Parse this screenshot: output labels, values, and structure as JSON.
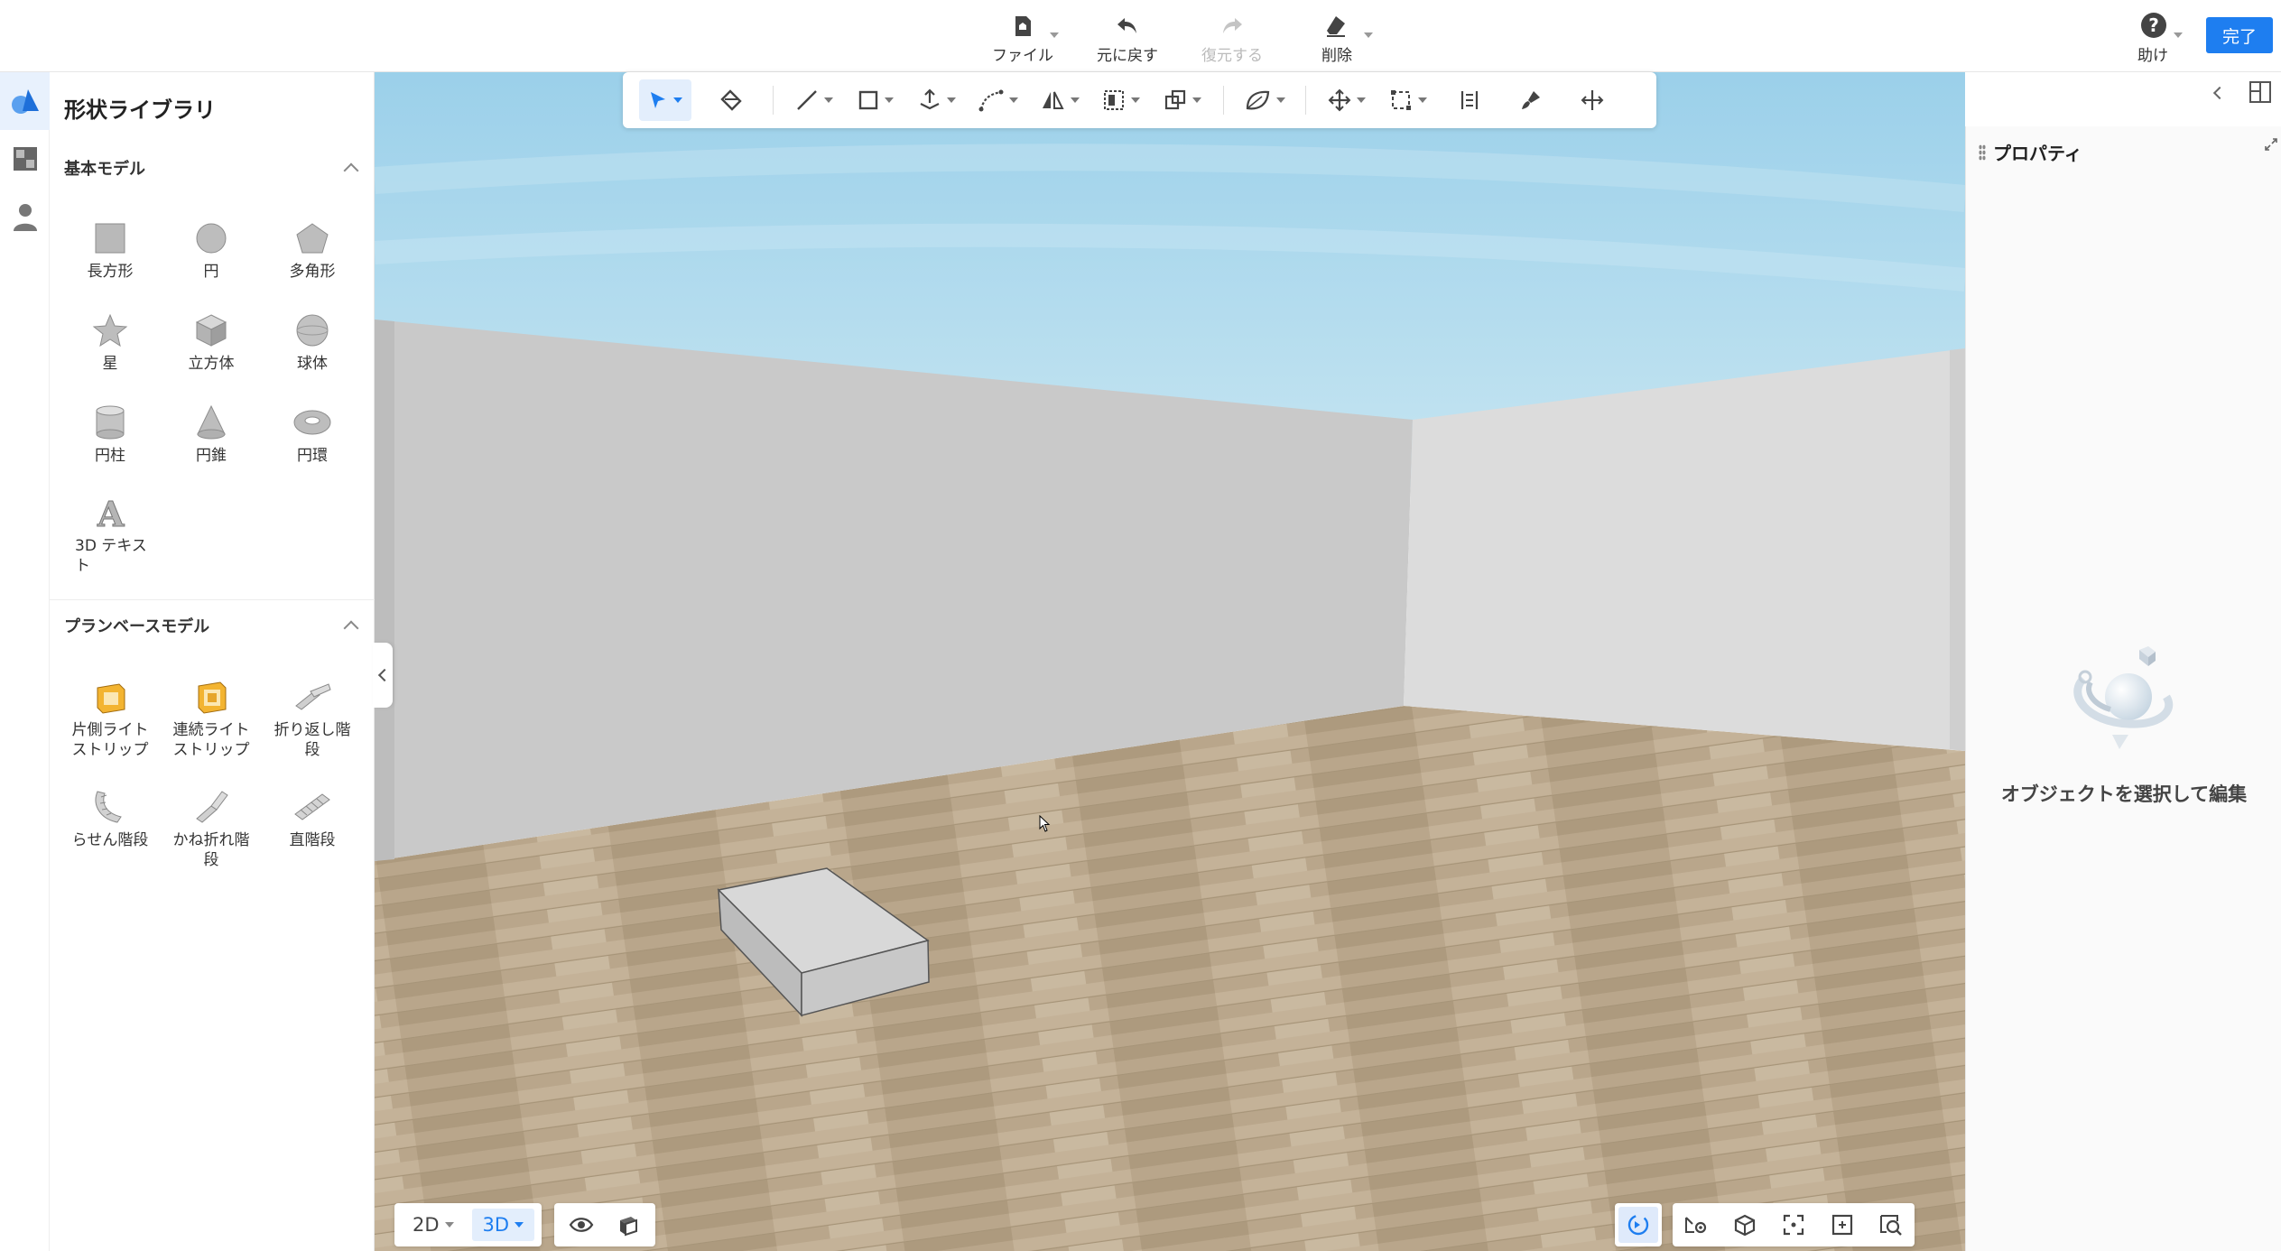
{
  "topbar": {
    "actions": [
      {
        "label": "ファイル",
        "icon": "file-home-icon",
        "has_caret": true,
        "enabled": true
      },
      {
        "label": "元に戻す",
        "icon": "undo-icon",
        "has_caret": false,
        "enabled": true
      },
      {
        "label": "復元する",
        "icon": "redo-icon",
        "has_caret": false,
        "enabled": false
      },
      {
        "label": "削除",
        "icon": "eraser-icon",
        "has_caret": true,
        "enabled": true
      }
    ],
    "help_label": "助け",
    "done_label": "完了"
  },
  "library": {
    "title": "形状ライブラリ",
    "basic_section": {
      "title": "基本モデル",
      "items": [
        "長方形",
        "円",
        "多角形",
        "星",
        "立方体",
        "球体",
        "円柱",
        "円錐",
        "円環",
        "3D テキスト"
      ]
    },
    "plan_section": {
      "title": "プランベースモデル",
      "items": [
        "片側ライトストリップ",
        "連続ライトストリップ",
        "折り返し階段",
        "らせん階段",
        "かね折れ階段",
        "直階段"
      ]
    }
  },
  "viewport": {
    "view_modes": [
      "2D",
      "3D"
    ],
    "active_view": "3D"
  },
  "properties": {
    "title": "プロパティ",
    "empty_text": "オブジェクトを選択して編集"
  },
  "colors": {
    "accent": "#1e7ef0",
    "floor": "#b8a58a",
    "left_wall": "#c8c8c8",
    "right_wall": "#dcdcdc",
    "sky": "#a9d5ea"
  }
}
